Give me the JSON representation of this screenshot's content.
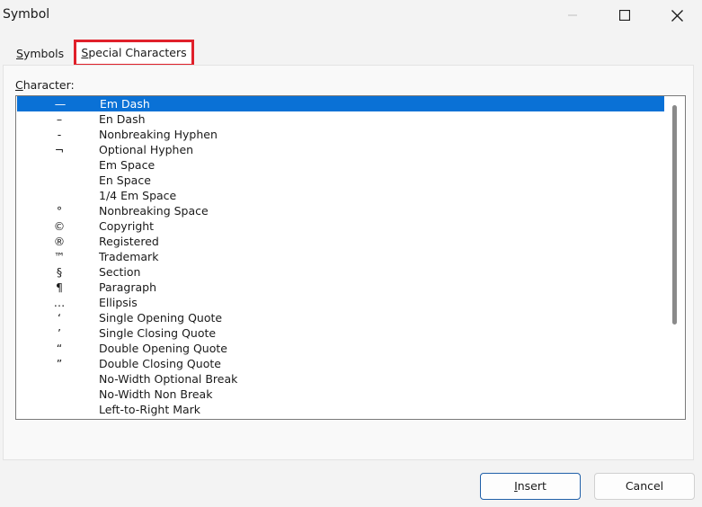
{
  "window": {
    "title": "Symbol",
    "minimize_icon": "minimize-icon",
    "maximize_icon": "maximize-icon",
    "close_icon": "close-icon"
  },
  "tabs": [
    {
      "label_prefix": "",
      "label_access": "S",
      "label_rest": "ymbols",
      "active": false
    },
    {
      "label_prefix": "",
      "label_access": "S",
      "label_rest": "pecial Characters",
      "active": true,
      "highlight_color": "#e0202a"
    }
  ],
  "character_label_access": "C",
  "character_label_rest": "haracter:",
  "characters": [
    {
      "glyph": "—",
      "name": "Em Dash",
      "selected": true
    },
    {
      "glyph": "–",
      "name": "En Dash"
    },
    {
      "glyph": "-",
      "name": "Nonbreaking Hyphen"
    },
    {
      "glyph": "¬",
      "name": "Optional Hyphen"
    },
    {
      "glyph": "",
      "name": "Em Space"
    },
    {
      "glyph": "",
      "name": "En Space"
    },
    {
      "glyph": "",
      "name": "1/4 Em Space"
    },
    {
      "glyph": "°",
      "name": "Nonbreaking Space"
    },
    {
      "glyph": "©",
      "name": "Copyright"
    },
    {
      "glyph": "®",
      "name": "Registered"
    },
    {
      "glyph": "™",
      "name": "Trademark"
    },
    {
      "glyph": "§",
      "name": "Section"
    },
    {
      "glyph": "¶",
      "name": "Paragraph"
    },
    {
      "glyph": "…",
      "name": "Ellipsis"
    },
    {
      "glyph": "‘",
      "name": "Single Opening Quote"
    },
    {
      "glyph": "’",
      "name": "Single Closing Quote"
    },
    {
      "glyph": "“",
      "name": "Double Opening Quote"
    },
    {
      "glyph": "”",
      "name": "Double Closing Quote"
    },
    {
      "glyph": "",
      "name": "No-Width Optional Break"
    },
    {
      "glyph": "",
      "name": "No-Width Non Break"
    },
    {
      "glyph": "",
      "name": "Left-to-Right Mark"
    }
  ],
  "buttons": {
    "insert_access": "I",
    "insert_rest": "nsert",
    "cancel": "Cancel"
  },
  "colors": {
    "selection": "#0a71d6",
    "tab_highlight": "#e0202a",
    "default_button_border": "#1f5fa8"
  }
}
